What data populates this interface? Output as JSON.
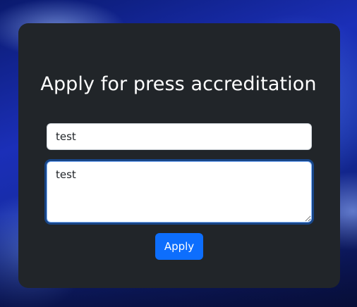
{
  "form": {
    "title": "Apply for press accreditation",
    "name_value": "test",
    "message_value": "test",
    "submit_label": "Apply"
  },
  "colors": {
    "card_background": "#212529",
    "button_primary": "#0d6efd",
    "focus_ring": "#86b7fe"
  }
}
